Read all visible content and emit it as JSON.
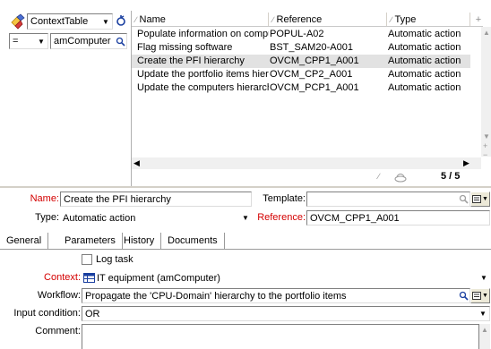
{
  "filter": {
    "table_value": "ContextTable",
    "operator_value": "=",
    "value_field": "amComputer"
  },
  "grid": {
    "columns": [
      "Name",
      "Reference",
      "Type"
    ],
    "rows": [
      {
        "name": "Populate information on computers",
        "reference": "POPUL-A02",
        "type": "Automatic action"
      },
      {
        "name": "Flag missing software",
        "reference": "BST_SAM20-A001",
        "type": "Automatic action"
      },
      {
        "name": "Create the PFI hierarchy",
        "reference": "OVCM_CPP1_A001",
        "type": "Automatic action"
      },
      {
        "name": "Update the portfolio items hierarc...",
        "reference": "OVCM_CP2_A001",
        "type": "Automatic action"
      },
      {
        "name": "Update the computers hierarchy",
        "reference": "OVCM_PCP1_A001",
        "type": "Automatic action"
      }
    ],
    "count": "5 / 5"
  },
  "detail": {
    "name_label": "Name:",
    "name_value": "Create the PFI hierarchy",
    "template_label": "Template:",
    "template_value": "",
    "type_label": "Type:",
    "type_value": "Automatic action",
    "reference_label": "Reference:",
    "reference_value": "OVCM_CPP1_A001"
  },
  "tabs": [
    "General",
    "Parameters",
    "History",
    "Documents"
  ],
  "general": {
    "log_task_label": "Log task",
    "context_label": "Context:",
    "context_value": "IT equipment (amComputer)",
    "workflow_label": "Workflow:",
    "workflow_value": "Propagate the 'CPU-Domain' hierarchy to the portfolio items",
    "input_condition_label": "Input condition:",
    "input_condition_value": "OR",
    "comment_label": "Comment:",
    "comment_value": ""
  },
  "colors": {
    "mandatory_label": "#d40000",
    "selected_row": "#e2e2e2",
    "panel_bg": "#ffffff"
  }
}
